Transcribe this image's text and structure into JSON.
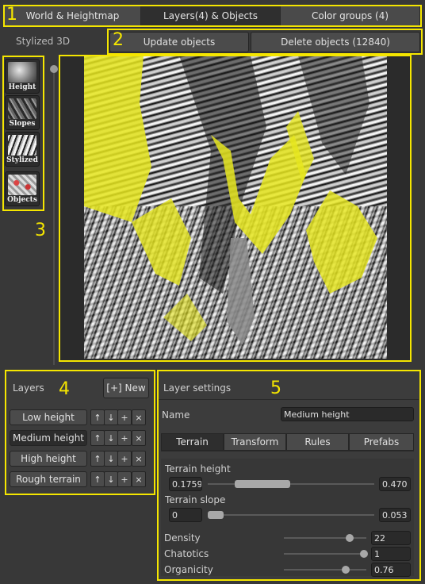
{
  "top_tabs": [
    {
      "label": "World & Heightmap",
      "active": false
    },
    {
      "label": "Layers(4) & Objects",
      "active": true
    },
    {
      "label": "Color groups (4)",
      "active": false
    }
  ],
  "viewport": {
    "mode_title": "Stylized 3D",
    "update_label": "Update objects",
    "delete_label": "Delete objects (12840)"
  },
  "view_modes": [
    {
      "label": "Height"
    },
    {
      "label": "Slopes"
    },
    {
      "label": "Stylized"
    },
    {
      "label": "Objects"
    }
  ],
  "layers_panel": {
    "title": "Layers",
    "new_label": "[+] New",
    "items": [
      {
        "label": "Low height",
        "selected": false
      },
      {
        "label": "Medium height",
        "selected": true
      },
      {
        "label": "High height",
        "selected": false
      },
      {
        "label": "Rough terrain",
        "selected": false
      }
    ],
    "row_buttons": [
      "↑",
      "↓",
      "+",
      "×"
    ]
  },
  "layer_settings": {
    "title": "Layer settings",
    "name_label": "Name",
    "name_value": "Medium height",
    "tabs": [
      {
        "label": "Terrain",
        "active": true
      },
      {
        "label": "Transform",
        "active": false
      },
      {
        "label": "Rules",
        "active": false
      },
      {
        "label": "Prefabs",
        "active": false
      }
    ],
    "terrain_height": {
      "label": "Terrain height",
      "min": "0.1759",
      "max": "0.470"
    },
    "terrain_slope": {
      "label": "Terrain slope",
      "min": "0",
      "max": "0.053"
    },
    "density": {
      "label": "Density",
      "value": "22",
      "fraction": 0.73
    },
    "chaotics": {
      "label": "Chatotics",
      "value": "1",
      "fraction": 1.0
    },
    "organicity": {
      "label": "Organicity",
      "value": "0.76",
      "fraction": 0.68
    }
  },
  "annotations": [
    "1",
    "2",
    "3",
    "4",
    "5"
  ],
  "colors": {
    "annotation": "#f5e600",
    "highlight_overlay": "#e6e61e",
    "background": "#383838"
  }
}
